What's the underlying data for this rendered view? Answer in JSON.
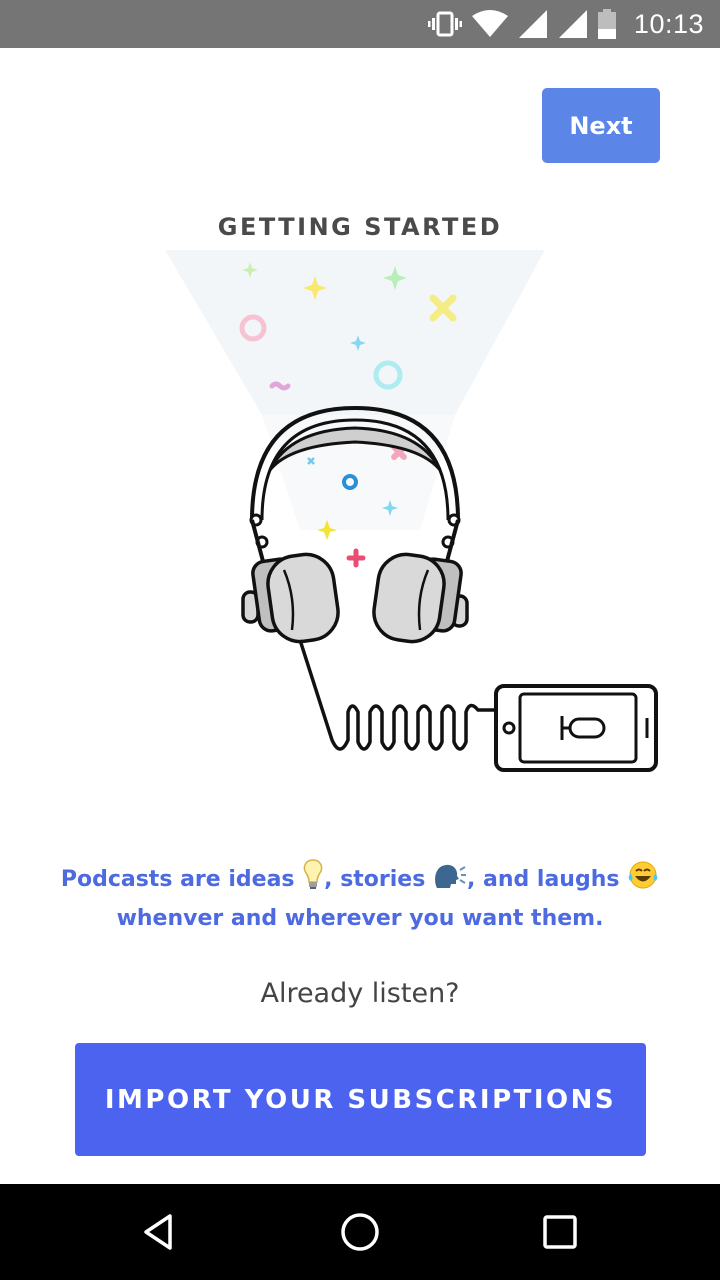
{
  "status_bar": {
    "time": "10:13",
    "icons": [
      "vibrate-icon",
      "wifi-icon",
      "signal-icon",
      "signal-icon",
      "battery-icon"
    ]
  },
  "header": {
    "next_label": "Next"
  },
  "onboarding": {
    "title": "GETTING STARTED",
    "tagline_part1": "Podcasts are ideas ",
    "tagline_part2": ", stories ",
    "tagline_part3": ", and laughs ",
    "tagline_part4": " whenver and wherever you want them.",
    "emoji_1": "lightbulb-icon",
    "emoji_2": "speaking-head-icon",
    "emoji_3": "tears-of-joy-icon",
    "already_listen": "Already listen?",
    "import_label": "IMPORT YOUR SUBSCRIPTIONS"
  },
  "colors": {
    "status_bar": "#757575",
    "next_button": "#5b85e6",
    "import_button": "#4b63ef",
    "tagline": "#4d6ae0"
  },
  "nav_bar": {
    "icons": [
      "back-icon",
      "home-icon",
      "recents-icon"
    ]
  }
}
